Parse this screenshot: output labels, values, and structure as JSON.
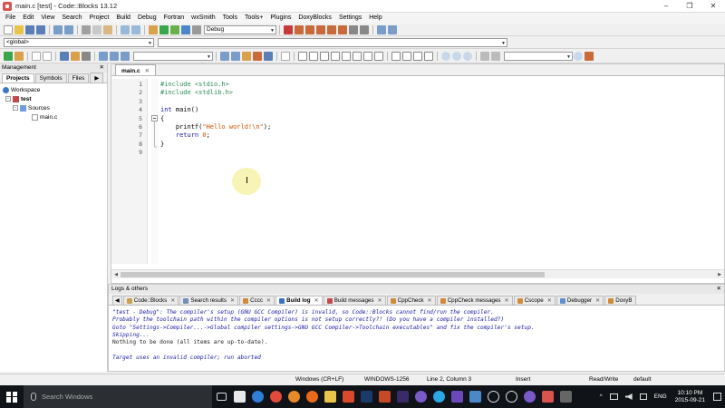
{
  "window": {
    "title": "main.c [test] - Code::Blocks 13.12",
    "controls": [
      "–",
      "❐",
      "✕"
    ]
  },
  "menu": [
    "File",
    "Edit",
    "View",
    "Search",
    "Project",
    "Build",
    "Debug",
    "Fortran",
    "wxSmith",
    "Tools",
    "Tools+",
    "Plugins",
    "DoxyBlocks",
    "Settings",
    "Help"
  ],
  "toolbar": {
    "build_target": "Debug",
    "scope": "<global>",
    "function_combo": "",
    "search_combo": ""
  },
  "management": {
    "title": "Management",
    "close": "✕",
    "tabs": [
      "Projects",
      "Symbols",
      "Files"
    ],
    "tab_arrow": "▶",
    "tree": {
      "workspace": "Workspace",
      "project": "test",
      "folder": "Sources",
      "file": "main.c"
    }
  },
  "editor": {
    "tab": "main.c",
    "close": "✕",
    "line_numbers": [
      "1",
      "2",
      "3",
      "4",
      "5",
      "6",
      "7",
      "8",
      "9"
    ],
    "code": {
      "l1": "#include <stdio.h>",
      "l2": "#include <stdlib.h>",
      "l4_kw": "int",
      "l4_rest": " main()",
      "l5": "{",
      "l6_fn": "    printf(",
      "l6_str": "\"Hello world!\\n\"",
      "l6_end": ");",
      "l7_kw": "    return",
      "l7_num": " 0",
      "l7_end": ";",
      "l8": "}"
    }
  },
  "logs": {
    "title": "Logs & others",
    "close": "✕",
    "tabs": [
      {
        "label": "Code::Blocks",
        "color": "#c8a050"
      },
      {
        "label": "Search results",
        "color": "#6f8fb5"
      },
      {
        "label": "Cccc",
        "color": "#d08a3a"
      },
      {
        "label": "Build log",
        "color": "#3b6fc4"
      },
      {
        "label": "Build messages",
        "color": "#c04a4a"
      },
      {
        "label": "CppCheck",
        "color": "#d08a3a"
      },
      {
        "label": "CppCheck messages",
        "color": "#d08a3a"
      },
      {
        "label": "Cscope",
        "color": "#d08a3a"
      },
      {
        "label": "Debugger",
        "color": "#5b8fd0"
      },
      {
        "label": "DoxyB",
        "color": "#d08a3a"
      }
    ],
    "active_tab": "Build log",
    "lines": [
      {
        "text": "\"test - Debug\": The compiler's setup (GNU GCC Compiler) is invalid, so Code::Blocks cannot find/run the compiler.",
        "kind": "err"
      },
      {
        "text": "Probably the toolchain path within the compiler options is not setup correctly?! (Do you have a compiler installed?)",
        "kind": "err"
      },
      {
        "text": "Goto \"Settings->Compiler...->Global compiler settings->GNU GCC Compiler->Toolchain executables\" and fix the compiler's setup.",
        "kind": "err"
      },
      {
        "text": "Skipping...",
        "kind": "err"
      },
      {
        "text": "Nothing to be done (all items are up-to-date).",
        "kind": "norm"
      },
      {
        "text": "",
        "kind": "norm"
      },
      {
        "text": "Target uses an invalid compiler; run aborted",
        "kind": "err"
      }
    ]
  },
  "status": {
    "eol": "Windows (CR+LF)",
    "encoding": "WINDOWS-1256",
    "position": "Line 2, Column 3",
    "mode": "Insert",
    "access": "Read/Write",
    "profile": "default"
  },
  "taskbar": {
    "search_placeholder": "Search Windows",
    "time": "10:10 PM",
    "date": "2015-09-21",
    "lang": "ENG",
    "tray_arrow": "^"
  }
}
